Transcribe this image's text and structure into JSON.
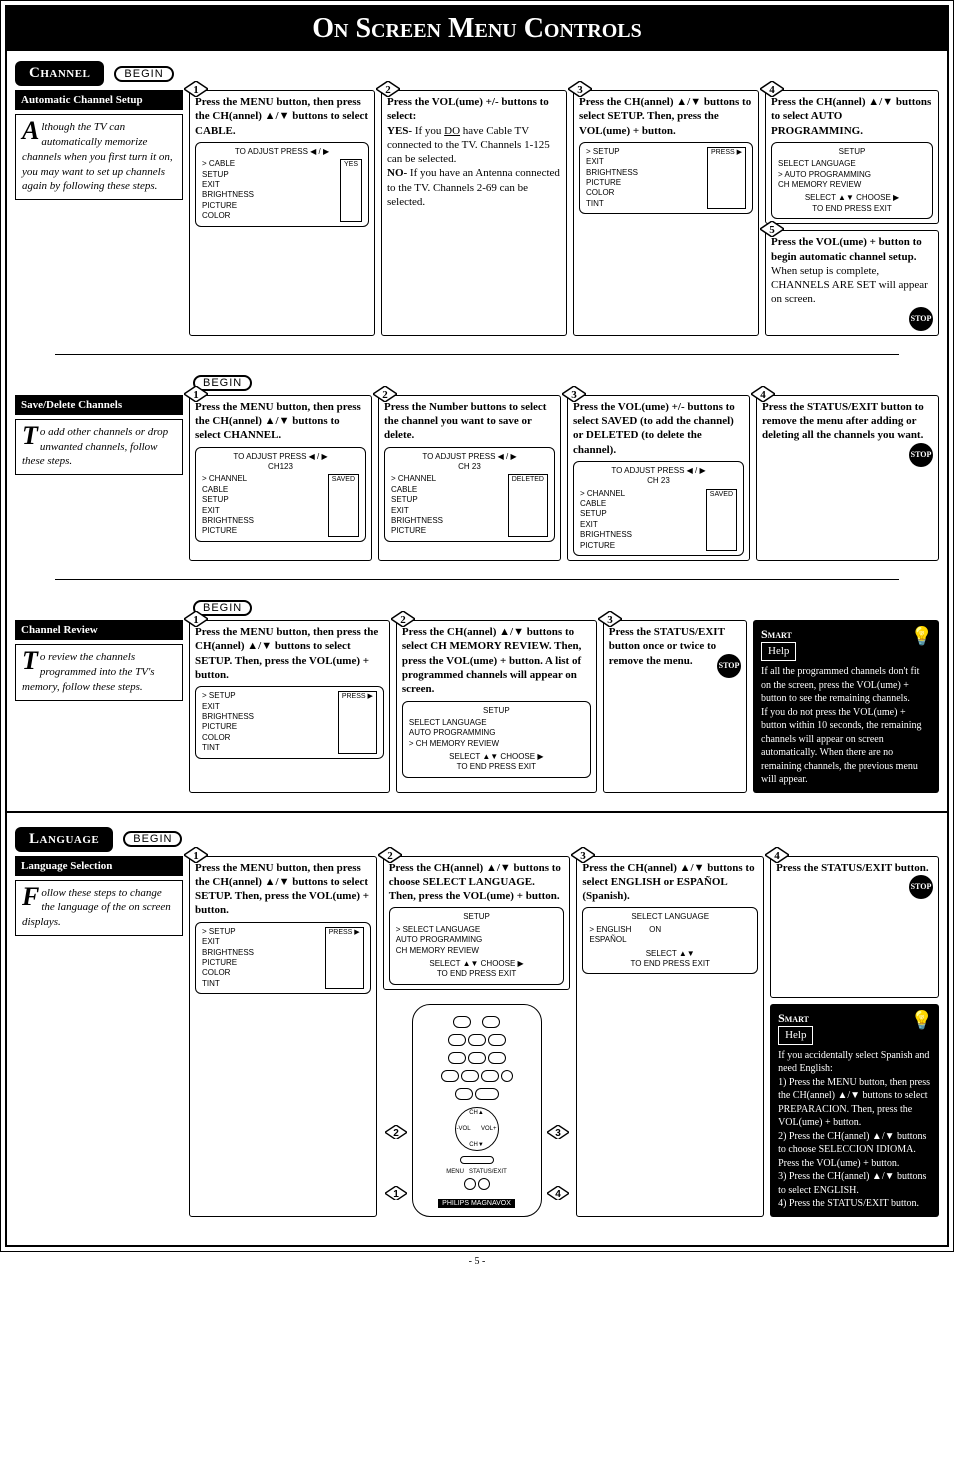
{
  "title": "On Screen Menu Controls",
  "sections": {
    "channel": {
      "tab": "Channel",
      "begin": "BEGIN",
      "auto": {
        "heading": "Automatic Channel Setup",
        "desc": "lthough the TV can automatically memorize channels when you first turn it on, you may want to set up channels again by following these steps.",
        "cap": "A",
        "s1": "Press the MENU button, then press the CH(annel) ▲/▼ buttons to select CABLE.",
        "s1_osd_top": "TO ADJUST PRESS ◀ / ▶",
        "s1_osd_items": "> CABLE\nSETUP\nEXIT\nBRIGHTNESS\nPICTURE\nCOLOR",
        "s1_osd_btn": "YES",
        "s2a": "Press the VOL(ume) +/- buttons to select:",
        "s2b": "YES- If you DO have Cable TV connected to the TV. Channels 1-125 can be selected.",
        "s2c": "NO- If you have an Antenna connected to the TV. Channels 2-69 can be selected.",
        "s3": "Press the CH(annel) ▲/▼ buttons to select SETUP. Then, press the VOL(ume) + button.",
        "s3_osd_items": "> SETUP\nEXIT\nBRIGHTNESS\nPICTURE\nCOLOR\nTINT",
        "s3_osd_btn": "PRESS ▶",
        "s4": "Press the CH(annel) ▲/▼ buttons to select AUTO PROGRAMMING.",
        "s4_osd_title": "SETUP",
        "s4_osd_items": "SELECT LANGUAGE\n> AUTO PROGRAMMING\nCH MEMORY REVIEW",
        "s4_osd_foot": "SELECT ▲▼ CHOOSE ▶\nTO END PRESS EXIT",
        "s5": "Press the VOL(ume) + button to begin automatic channel setup.",
        "s5b": "When setup is complete, CHANNELS ARE SET will appear on screen.",
        "stop": "STOP"
      },
      "save": {
        "heading": "Save/Delete Channels",
        "cap": "T",
        "desc": "o add other channels or drop unwanted channels, follow these steps.",
        "s1": "Press the MENU button, then press the CH(annel) ▲/▼ buttons to select CHANNEL.",
        "s1_osd_top": "TO ADJUST PRESS ◀ / ▶\nCH123",
        "s1_osd_items": "> CHANNEL\nCABLE\nSETUP\nEXIT\nBRIGHTNESS\nPICTURE",
        "s1_osd_btn": "SAVED",
        "s2": "Press the Number buttons to select the channel you want to save or delete.",
        "s2_osd_top": "TO ADJUST PRESS ◀ / ▶\nCH 23",
        "s2_osd_items": "> CHANNEL\nCABLE\nSETUP\nEXIT\nBRIGHTNESS\nPICTURE",
        "s2_osd_btn": "DELETED",
        "s3": "Press the VOL(ume) +/- buttons to select SAVED (to add the channel) or DELETED (to delete the channel).",
        "s3_osd_top": "TO ADJUST PRESS ◀ / ▶\nCH 23",
        "s3_osd_items": "> CHANNEL\nCABLE\nSETUP\nEXIT\nBRIGHTNESS\nPICTURE",
        "s3_osd_btn": "SAVED",
        "s4": "Press the STATUS/EXIT button to remove the menu after adding or deleting all the channels you want.",
        "stop": "STOP"
      },
      "review": {
        "heading": "Channel Review",
        "cap": "T",
        "desc": "o review the channels programmed into the TV's memory, follow these steps.",
        "s1": "Press the MENU button, then press the CH(annel) ▲/▼ buttons to select SETUP. Then, press the VOL(ume) + button.",
        "s1_osd_items": "> SETUP\nEXIT\nBRIGHTNESS\nPICTURE\nCOLOR\nTINT",
        "s1_osd_btn": "PRESS ▶",
        "s2": "Press the CH(annel) ▲/▼ buttons to select CH MEMORY REVIEW. Then, press the VOL(ume) + button. A list of programmed channels will appear on screen.",
        "s2_osd_title": "SETUP",
        "s2_osd_items": "SELECT LANGUAGE\nAUTO PROGRAMMING\n> CH MEMORY REVIEW",
        "s2_osd_foot": "SELECT ▲▼ CHOOSE ▶\nTO END PRESS EXIT",
        "s3": "Press the STATUS/EXIT button once or twice to remove the menu.",
        "stop": "STOP",
        "help_t": "Smart",
        "help_h": "Help",
        "help": "If all the programmed channels don't fit on the screen, press the VOL(ume) + button to see the remaining channels.\nIf you do not press the VOL(ume) + button within 10 seconds, the remaining channels will appear on screen automatically. When there are no remaining channels, the previous menu will appear."
      }
    },
    "language": {
      "tab": "Language",
      "begin": "BEGIN",
      "heading": "Language Selection",
      "cap": "F",
      "desc": "ollow these steps to change the language of the on screen displays.",
      "s1": "Press the MENU button, then press the CH(annel) ▲/▼ buttons to select SETUP. Then, press the VOL(ume) + button.",
      "s1_osd_items": "> SETUP\nEXIT\nBRIGHTNESS\nPICTURE\nCOLOR\nTINT",
      "s1_osd_btn": "PRESS ▶",
      "s2": "Press the CH(annel) ▲/▼ buttons to choose SELECT LANGUAGE. Then, press the VOL(ume) + button.",
      "s2_osd_title": "SETUP",
      "s2_osd_items": "> SELECT LANGUAGE\nAUTO PROGRAMMING\nCH MEMORY REVIEW",
      "s2_osd_foot": "SELECT ▲▼ CHOOSE ▶\nTO END PRESS EXIT",
      "s3": "Press the CH(annel) ▲/▼ buttons to select ENGLISH or ESPAÑOL (Spanish).",
      "s3_osd_title": "SELECT LANGUAGE",
      "s3_osd_items": "> ENGLISH        ON\nESPAÑOL",
      "s3_osd_foot": "SELECT ▲▼\nTO END PRESS EXIT",
      "s4": "Press the STATUS/EXIT button.",
      "stop": "STOP",
      "help_t": "Smart",
      "help_h": "Help",
      "help": "If you accidentally select Spanish and need English:\n1) Press the MENU button, then press the CH(annel) ▲/▼ buttons to select PREPARACION. Then, press the VOL(ume) + button.\n2) Press the CH(annel) ▲/▼ buttons to choose SELECCION IDIOMA. Press the VOL(ume) + button.\n3) Press the CH(annel) ▲/▼ buttons to select ENGLISH.\n4) Press the STATUS/EXIT button.",
      "remote_logo": "PHILIPS MAGNAVOX"
    }
  },
  "page_num": "- 5 -"
}
